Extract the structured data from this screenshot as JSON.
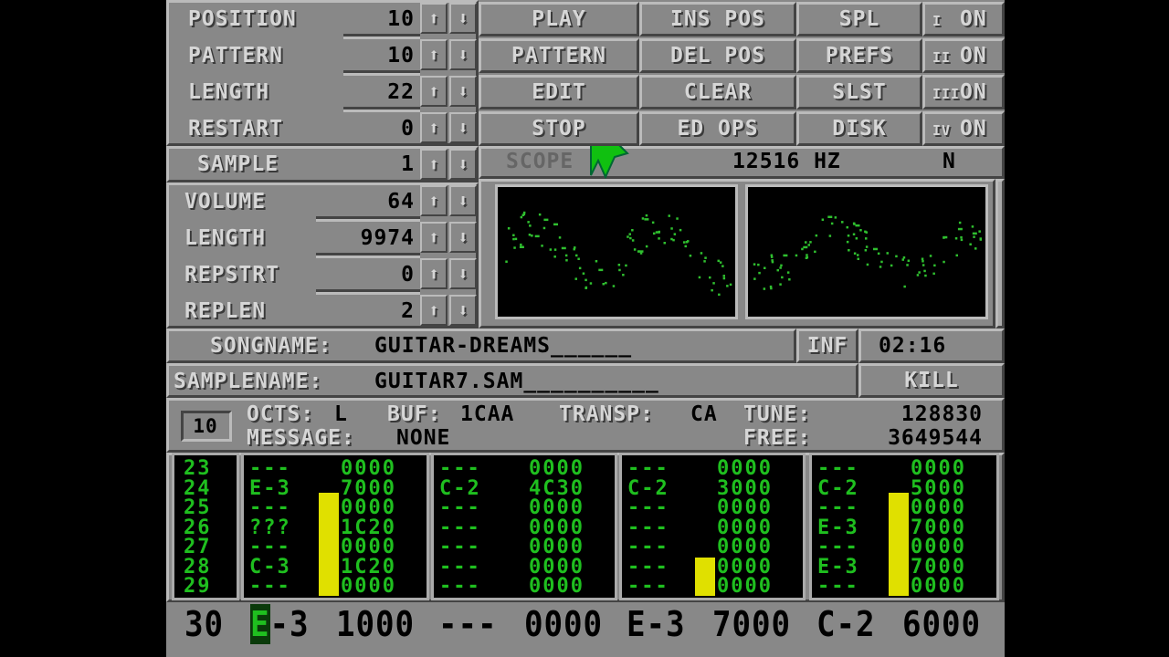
{
  "app": "ProTracker",
  "song_controls": [
    {
      "label": "POSITION",
      "value": "10"
    },
    {
      "label": "PATTERN",
      "value": "10"
    },
    {
      "label": "LENGTH",
      "value": "22"
    },
    {
      "label": "RESTART",
      "value": "0"
    }
  ],
  "sample_control": {
    "label": "SAMPLE",
    "value": "1"
  },
  "sample_params": [
    {
      "label": "VOLUME",
      "value": "64"
    },
    {
      "label": "LENGTH",
      "value": "9974"
    },
    {
      "label": "REPSTRT",
      "value": "0"
    },
    {
      "label": "REPLEN",
      "value": "2"
    }
  ],
  "arrows": {
    "up": "⬆",
    "down": "⬇"
  },
  "buttons": {
    "col1": [
      "PLAY",
      "PATTERN",
      "EDIT",
      "STOP"
    ],
    "col2": [
      "INS POS",
      "DEL POS",
      "CLEAR",
      "ED OPS"
    ],
    "col3": [
      "SPL",
      "PREFS",
      "SLST",
      "DISK"
    ],
    "channels": [
      {
        "num": "I",
        "state": "ON"
      },
      {
        "num": "II",
        "state": "ON"
      },
      {
        "num": "III",
        "state": "ON"
      },
      {
        "num": "IV",
        "state": "ON"
      }
    ]
  },
  "scope": {
    "label": "SCOPE",
    "freq": "12516 HZ",
    "mode": "N"
  },
  "song": {
    "label": "SONGNAME:",
    "name": "GUITAR-DREAMS______",
    "inf_label": "INF",
    "time": "02:16"
  },
  "sample_name": {
    "label": "SAMPLENAME:",
    "name": "GUITAR7.SAM__________",
    "kill_label": "KILL"
  },
  "status": {
    "pattern_num": "10",
    "octs_label": "OCTS:",
    "octs": "L",
    "buf_label": "BUF:",
    "buf": "1CAA",
    "transp_label": "TRANSP:",
    "transp": "CA",
    "tune_label": "TUNE:",
    "tune": "128830",
    "message_label": "MESSAGE:",
    "message": "NONE",
    "free_label": "FREE:",
    "free": "3649544"
  },
  "pattern": {
    "rows": [
      "23",
      "24",
      "25",
      "26",
      "27",
      "28",
      "29"
    ],
    "tracks": [
      {
        "notes": [
          "---",
          "E-3",
          "---",
          "???",
          "---",
          "C-3",
          "---"
        ],
        "fx": [
          "0000",
          "7000",
          "0000",
          "1C20",
          "0000",
          "1C20",
          "0000"
        ],
        "vu": 0.75
      },
      {
        "notes": [
          "---",
          "C-2",
          "---",
          "---",
          "---",
          "---",
          "---"
        ],
        "fx": [
          "0000",
          "4C30",
          "0000",
          "0000",
          "0000",
          "0000",
          "0000"
        ],
        "vu": 0
      },
      {
        "notes": [
          "---",
          "C-2",
          "---",
          "---",
          "---",
          "---",
          "---"
        ],
        "fx": [
          "0000",
          "3000",
          "0000",
          "0000",
          "0000",
          "0000",
          "0000"
        ],
        "vu": 0.28
      },
      {
        "notes": [
          "---",
          "C-2",
          "---",
          "E-3",
          "---",
          "E-3",
          "---"
        ],
        "fx": [
          "0000",
          "5000",
          "0000",
          "7000",
          "0000",
          "7000",
          "0000"
        ],
        "vu": 0.75
      }
    ],
    "current_row": {
      "row": "30",
      "cells": [
        {
          "note": "E-3",
          "fx": "1000"
        },
        {
          "note": "---",
          "fx": "0000"
        },
        {
          "note": "E-3",
          "fx": "7000"
        },
        {
          "note": "C-2",
          "fx": "6000"
        }
      ]
    }
  },
  "colors": {
    "panel": "#888888",
    "pattern_text": "#1fbf1f",
    "vu": "#e0e000",
    "scope_dots": "#2fbf2f",
    "pointer": "#10c010"
  }
}
